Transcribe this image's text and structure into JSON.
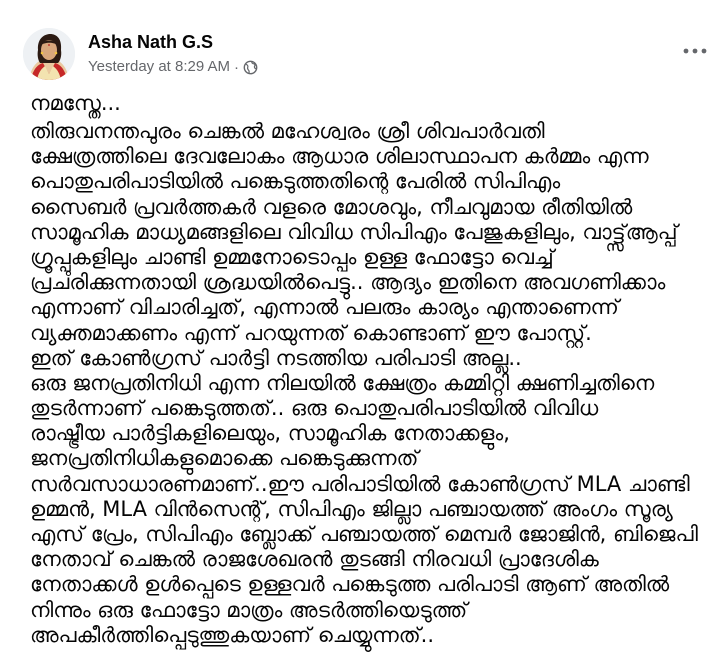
{
  "post": {
    "author": "Asha Nath G.S",
    "timestamp": "Yesterday at 8:29 AM",
    "separator": "·",
    "privacy_icon": "globe-icon",
    "more_icon": "more-horizontal-icon",
    "greeting": "നമസ്തേ...",
    "lines": [
      "തിരുവനന്തപുരം ചെങ്കൽ മഹേശ്വരം ശ്രീ ശിവപാർവതി",
      "ക്ഷേത്രത്തിലെ ദേവലോകം ആധാര ശിലാസ്ഥാപന കർമ്മം എന്ന",
      "പൊതുപരിപാടിയിൽ പങ്കെടുത്തതിന്റെ പേരിൽ സിപിഎം",
      "സൈബർ പ്രവർത്തകർ വളരെ മോശവും, നീചവുമായ രീതിയിൽ",
      "സാമൂഹിക മാധ്യമങ്ങളിലെ വിവിധ സിപിഎം പേജുകളിലും, വാട്ട്സ്ആപ്പ്",
      "ഗ്രൂപ്പുകളിലും ചാണ്ടി ഉമ്മനോടൊപ്പം ഉള്ള ഫോട്ടോ വെച്ച്",
      "പ്രചരിക്കുന്നതായി ശ്രദ്ധയിൽപെട്ടു.. ആദ്യം ഇതിനെ അവഗണിക്കാം",
      "എന്നാണ് വിചാരിച്ചത്, എന്നാൽ പലരും കാര്യം എന്താണെന്ന്",
      "വ്യക്തമാക്കണം എന്ന് പറയുന്നത് കൊണ്ടാണ് ഈ പോസ്റ്റ്.",
      "ഇത് കോൺഗ്രസ് പാർട്ടി നടത്തിയ പരിപാടി അല്ല..",
      "ഒരു ജനപ്രതിനിധി എന്ന നിലയിൽ ക്ഷേത്രം കമ്മിറ്റി ക്ഷണിച്ചതിനെ",
      "തുടർന്നാണ് പങ്കെടുത്തത്.. ഒരു പൊതുപരിപാടിയിൽ വിവിധ",
      "രാഷ്ട്രീയ പാർട്ടികളിലെയും, സാമൂഹിക നേതാക്കളും,",
      "ജനപ്രതിനിധികളുമൊക്കെ പങ്കെടുക്കുന്നത്",
      "സർവസാധാരണമാണ്..ഈ പരിപാടിയിൽ കോൺഗ്രസ് MLA ചാണ്ടി",
      "ഉമ്മൻ, MLA വിൻസെന്റ്, സിപിഎം ജില്ലാ പഞ്ചായത്ത് അംഗം സൂര്യ",
      "എസ് പ്രേം, സിപിഎം ബ്ലോക്ക് പഞ്ചായത്ത് മെമ്പർ ജോജിൻ, ബിജെപി",
      "നേതാവ് ചെങ്കൽ രാജശേഖരൻ തുടങ്ങി നിരവധി പ്രാദേശിക",
      "നേതാക്കൾ ഉൾപ്പെടെ ഉള്ളവർ പങ്കെടുത്ത പരിപാടി ആണ് അതിൽ",
      "നിന്നും ഒരു ഫോട്ടോ മാത്രം അടർത്തിയെടുത്ത്",
      "അപകീർത്തിപ്പെടുത്തുകയാണ് ചെയ്യുന്നത്.."
    ]
  }
}
